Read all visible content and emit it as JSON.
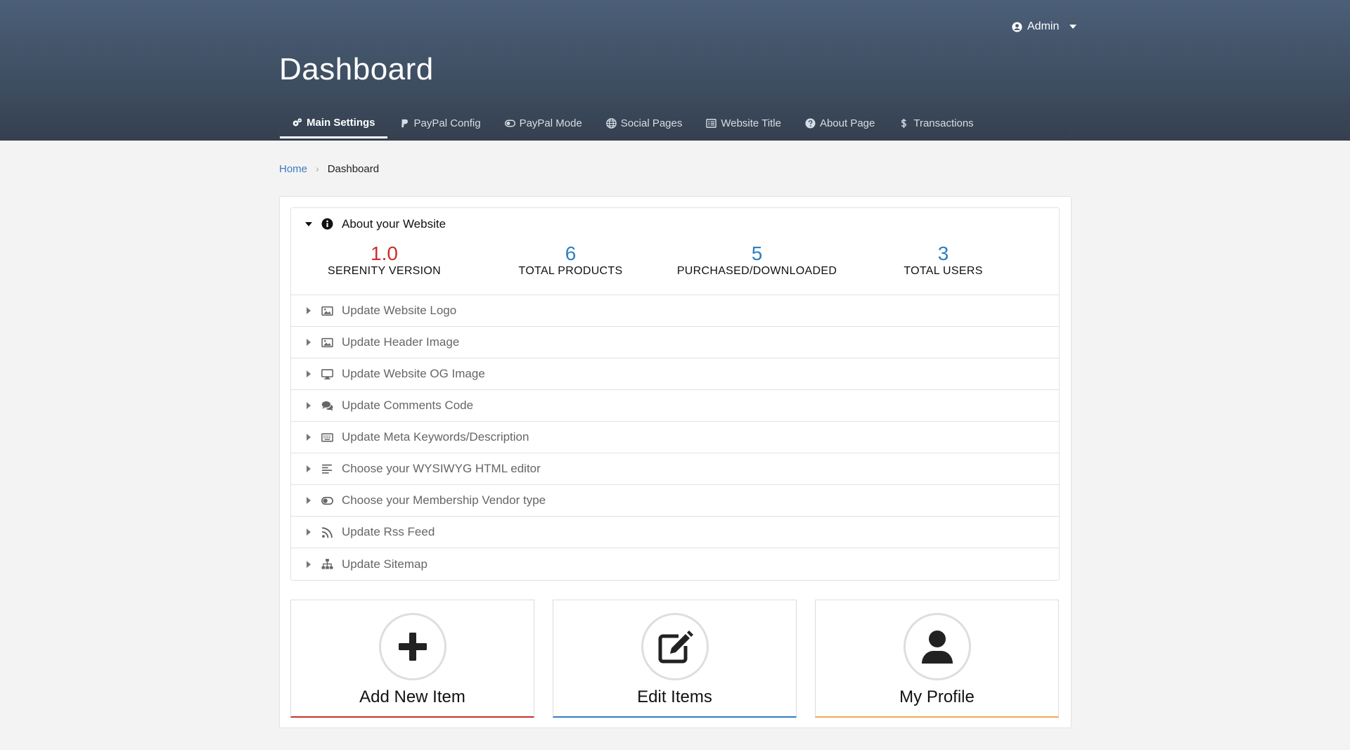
{
  "header": {
    "user": "Admin",
    "title": "Dashboard",
    "tabs": [
      {
        "label": "Main Settings",
        "icon": "gears-icon",
        "active": true
      },
      {
        "label": "PayPal Config",
        "icon": "paypal-icon",
        "active": false
      },
      {
        "label": "PayPal Mode",
        "icon": "toggle-icon",
        "active": false
      },
      {
        "label": "Social Pages",
        "icon": "globe-icon",
        "active": false
      },
      {
        "label": "Website Title",
        "icon": "list-icon",
        "active": false
      },
      {
        "label": "About Page",
        "icon": "question-circle-icon",
        "active": false
      },
      {
        "label": "Transactions",
        "icon": "dollar-icon",
        "active": false
      }
    ]
  },
  "breadcrumb": {
    "home": "Home",
    "current": "Dashboard"
  },
  "about": {
    "title": "About your Website",
    "stats": [
      {
        "value": "1.0",
        "label": "SERENITY VERSION",
        "color": "#c9302c"
      },
      {
        "value": "6",
        "label": "TOTAL PRODUCTS",
        "color": "#2f7fc1"
      },
      {
        "value": "5",
        "label": "PURCHASED/DOWNLOADED",
        "color": "#2f7fc1"
      },
      {
        "value": "3",
        "label": "TOTAL USERS",
        "color": "#2f7fc1"
      }
    ]
  },
  "settings": [
    {
      "label": "Update Website Logo",
      "icon": "image-icon"
    },
    {
      "label": "Update Header Image",
      "icon": "image-icon"
    },
    {
      "label": "Update Website OG Image",
      "icon": "desktop-icon"
    },
    {
      "label": "Update Comments Code",
      "icon": "comments-icon"
    },
    {
      "label": "Update Meta Keywords/Description",
      "icon": "keyboard-icon"
    },
    {
      "label": "Choose your WYSIWYG HTML editor",
      "icon": "align-left-icon"
    },
    {
      "label": "Choose your Membership Vendor type",
      "icon": "toggle-icon"
    },
    {
      "label": "Update Rss Feed",
      "icon": "rss-icon"
    },
    {
      "label": "Update Sitemap",
      "icon": "sitemap-icon"
    }
  ],
  "tiles": [
    {
      "label": "Add New Item",
      "icon": "plus-icon",
      "accent": "#c9302c"
    },
    {
      "label": "Edit Items",
      "icon": "edit-icon",
      "accent": "#2f7fc1"
    },
    {
      "label": "My Profile",
      "icon": "user-icon",
      "accent": "#f0ad4e"
    }
  ]
}
